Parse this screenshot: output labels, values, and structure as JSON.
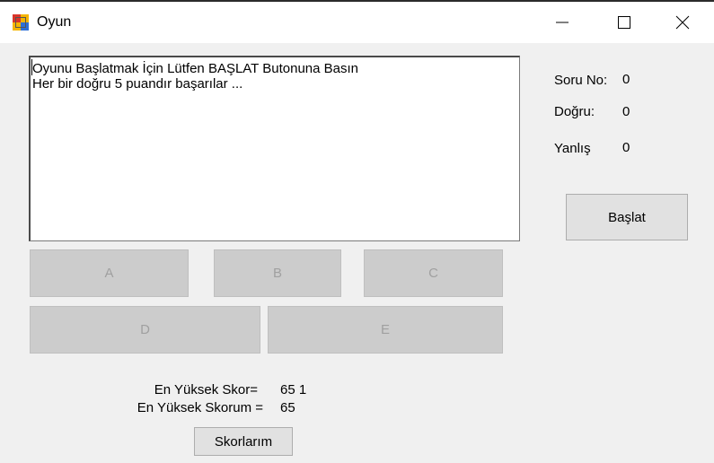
{
  "window": {
    "title": "Oyun"
  },
  "question_box": {
    "line1": "Oyunu Başlatmak İçin Lütfen BAŞLAT Butonuna Basın",
    "line2": "Her bir doğru 5 puandır başarılar ..."
  },
  "answers": [
    {
      "label": "A",
      "enabled": false
    },
    {
      "label": "B",
      "enabled": false
    },
    {
      "label": "C",
      "enabled": false
    },
    {
      "label": "D",
      "enabled": false
    },
    {
      "label": "E",
      "enabled": false
    }
  ],
  "stats": {
    "question_no_label": "Soru No:",
    "question_no_value": "0",
    "correct_label": "Doğru:",
    "correct_value": "0",
    "wrong_label": "Yanlış",
    "wrong_value": "0"
  },
  "start_button_label": "Başlat",
  "scores": {
    "high_score_label": "En Yüksek Skor=",
    "high_score_value": "65 1",
    "my_high_score_label": "En Yüksek Skorum =",
    "my_high_score_value": "65"
  },
  "scores_button_label": "Skorlarım",
  "colors": {
    "disabled_button_bg": "#cccccc",
    "disabled_text": "#a0a0a0",
    "button_bg": "#e1e1e1",
    "window_bg": "#f0f0f0"
  },
  "icons": {
    "app": "app-window-icon",
    "minimize": "minimize-icon",
    "maximize": "maximize-icon",
    "close": "close-icon"
  }
}
